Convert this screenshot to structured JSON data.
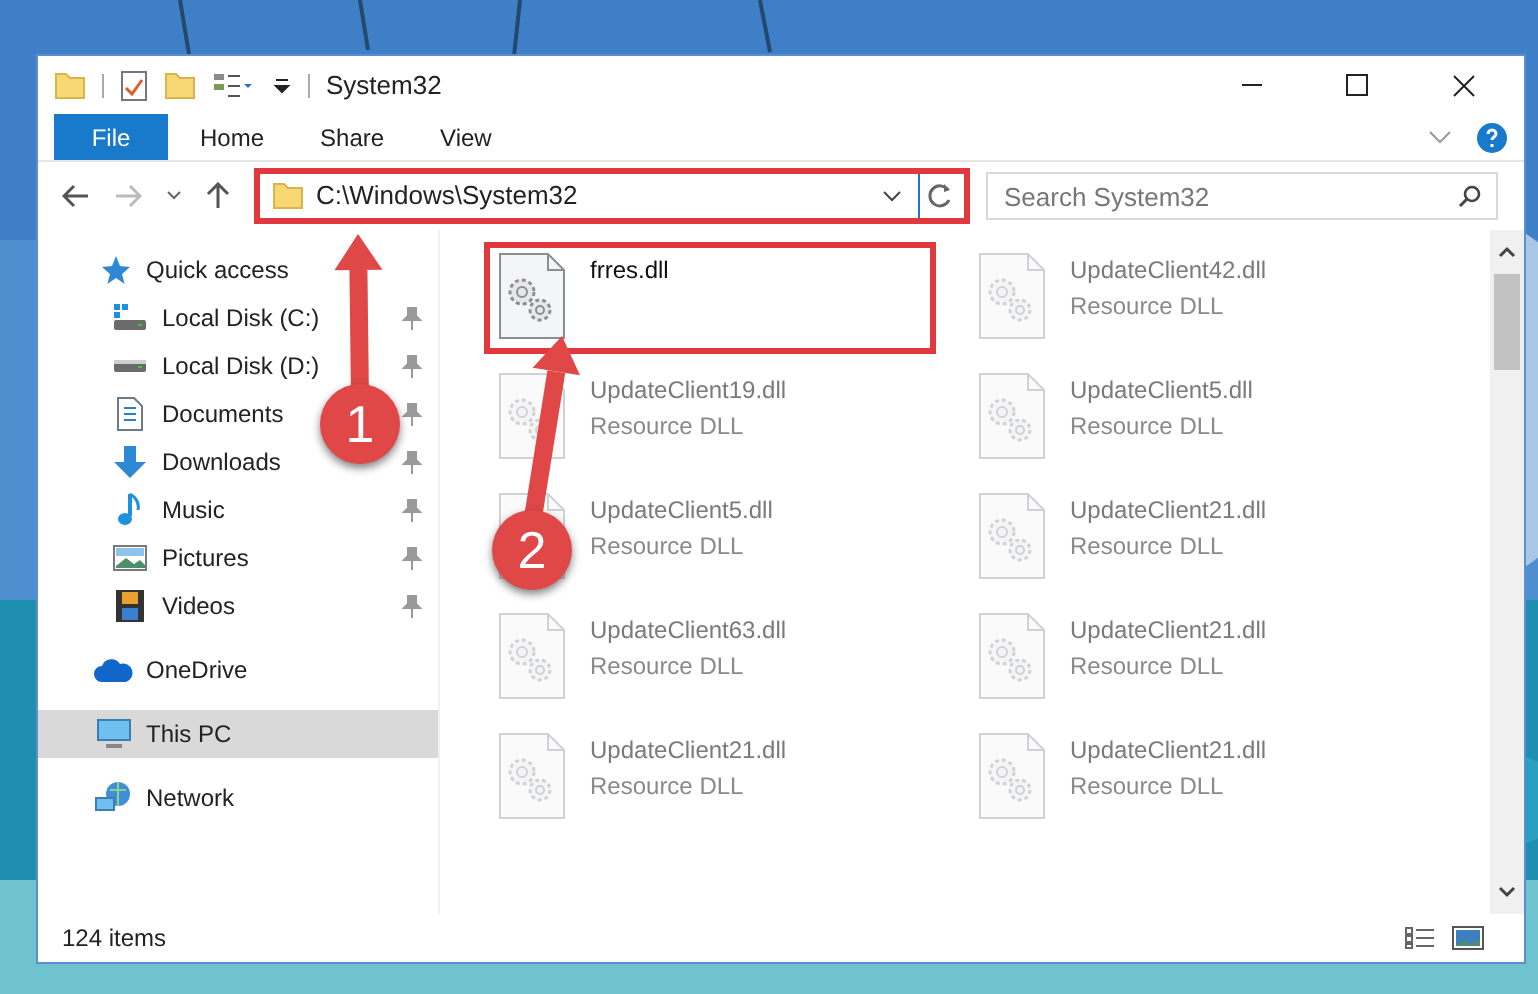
{
  "window": {
    "title": "System32"
  },
  "ribbon_tabs": [
    {
      "label": "File",
      "kind": "file"
    },
    {
      "label": "Home",
      "kind": "tab"
    },
    {
      "label": "Share",
      "kind": "tab"
    },
    {
      "label": "View",
      "kind": "tab"
    }
  ],
  "address_bar": {
    "path": "C:\\Windows\\System32",
    "highlighted": true
  },
  "search": {
    "placeholder": "Search System32"
  },
  "sidebar": {
    "items": [
      {
        "label": "Quick access",
        "kind": "star",
        "selected": false,
        "children": [
          {
            "label": "Local Disk (C:)",
            "kind": "disk-c",
            "pinned": true,
            "selected": false
          },
          {
            "label": "Local Disk (D:)",
            "kind": "disk",
            "pinned": true,
            "selected": false
          },
          {
            "label": "Documents",
            "kind": "document",
            "pinned": true,
            "selected": false
          },
          {
            "label": "Downloads",
            "kind": "download",
            "pinned": true,
            "selected": false
          },
          {
            "label": "Music",
            "kind": "music",
            "pinned": true,
            "selected": false
          },
          {
            "label": "Pictures",
            "kind": "pictures",
            "pinned": true,
            "selected": false
          },
          {
            "label": "Videos",
            "kind": "video",
            "pinned": true,
            "selected": false
          }
        ]
      },
      {
        "label": "OneDrive",
        "kind": "cloud",
        "selected": false
      },
      {
        "label": "This PC",
        "kind": "monitor",
        "selected": true
      },
      {
        "label": "Network",
        "kind": "network",
        "selected": false
      }
    ]
  },
  "files": [
    {
      "name": "frres.dll",
      "faded": false,
      "highlighted": true
    },
    {
      "name": "UpdateClient42.dll",
      "type": "Resource DLL",
      "faded": true,
      "highlighted": false
    },
    {
      "name": "UpdateClient19.dll",
      "type": "Resource DLL",
      "faded": true,
      "highlighted": false
    },
    {
      "name": "UpdateClient5.dll",
      "type": "Resource DLL",
      "faded": true,
      "highlighted": false
    },
    {
      "name": "UpdateClient5.dll",
      "type": "Resource DLL",
      "faded": true,
      "highlighted": false
    },
    {
      "name": "UpdateClient21.dll",
      "type": "Resource DLL",
      "faded": true,
      "highlighted": false
    },
    {
      "name": "UpdateClient63.dll",
      "type": "Resource DLL",
      "faded": true,
      "highlighted": false
    },
    {
      "name": "UpdateClient21.dll",
      "type": "Resource DLL",
      "faded": true,
      "highlighted": false
    },
    {
      "name": "UpdateClient21.dll",
      "type": "Resource DLL",
      "faded": true,
      "highlighted": false
    },
    {
      "name": "UpdateClient21.dll",
      "type": "Resource DLL",
      "faded": true,
      "highlighted": false
    }
  ],
  "status_bar": {
    "count": "124 items"
  },
  "annotations": [
    {
      "label": "1"
    },
    {
      "label": "2"
    }
  ]
}
